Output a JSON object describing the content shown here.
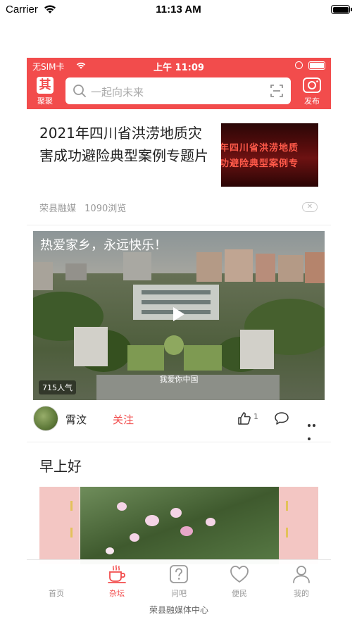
{
  "ios_status": {
    "carrier": "Carrier",
    "time": "11:13 AM"
  },
  "app_status": {
    "carrier": "无SIM卡",
    "time": "上午 11:09"
  },
  "header": {
    "left_button_label": "聚聚",
    "left_button_glyph": "其",
    "search_placeholder": "一起向未来",
    "right_button_label": "发布",
    "brand_color": "#f24c4c"
  },
  "article": {
    "title": "2021年四川省洪涝地质灾害成功避险典型案例专题片",
    "thumb_lines": [
      "年四川省洪涝地质",
      "功避险典型案例专"
    ],
    "source": "荣县融媒",
    "views": "1090浏览",
    "close_glyph": "✕"
  },
  "video_post": {
    "title": "热爱家乡，永远快乐！",
    "caption": "我爱你中国",
    "popularity": "715人气",
    "author": "霄汶",
    "follow_label": "关注",
    "like_count": "1"
  },
  "greeting_post": {
    "title": "早上好"
  },
  "tabbar": {
    "tabs": [
      {
        "label": "首页",
        "icon": "home-icon",
        "active": false
      },
      {
        "label": "杂坛",
        "icon": "coffee-icon",
        "active": true
      },
      {
        "label": "问吧",
        "icon": "question-icon",
        "active": false
      },
      {
        "label": "便民",
        "icon": "heart-icon",
        "active": false
      },
      {
        "label": "我的",
        "icon": "person-icon",
        "active": false
      }
    ],
    "footer_text": "荣县融媒体中心"
  }
}
